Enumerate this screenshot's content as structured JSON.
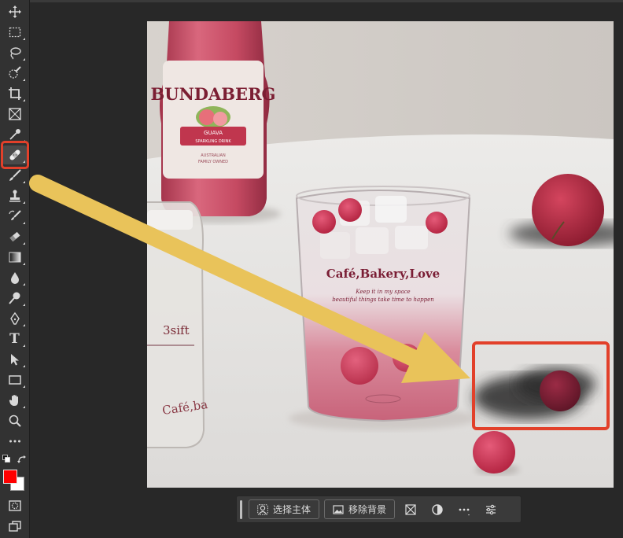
{
  "toolbar": {
    "tools": [
      {
        "name": "move-tool",
        "icon": "move-icon"
      },
      {
        "name": "marquee-tool",
        "icon": "marquee-icon"
      },
      {
        "name": "lasso-tool",
        "icon": "lasso-icon"
      },
      {
        "name": "quick-selection-tool",
        "icon": "quick-selection-icon"
      },
      {
        "name": "crop-tool",
        "icon": "crop-icon"
      },
      {
        "name": "frame-tool",
        "icon": "frame-icon"
      },
      {
        "name": "eyedropper-tool",
        "icon": "eyedropper-icon"
      },
      {
        "name": "spot-healing-brush-tool",
        "icon": "bandage-icon",
        "active": true
      },
      {
        "name": "brush-tool",
        "icon": "brush-icon"
      },
      {
        "name": "clone-stamp-tool",
        "icon": "stamp-icon"
      },
      {
        "name": "history-brush-tool",
        "icon": "history-brush-icon"
      },
      {
        "name": "eraser-tool",
        "icon": "eraser-icon"
      },
      {
        "name": "gradient-tool",
        "icon": "gradient-icon"
      },
      {
        "name": "blur-tool",
        "icon": "drop-icon"
      },
      {
        "name": "dodge-tool",
        "icon": "dodge-icon"
      },
      {
        "name": "pen-tool",
        "icon": "pen-icon"
      },
      {
        "name": "type-tool",
        "icon": "type-icon",
        "label": "T"
      },
      {
        "name": "path-selection-tool",
        "icon": "arrow-cursor-icon"
      },
      {
        "name": "rectangle-tool",
        "icon": "rectangle-icon"
      },
      {
        "name": "hand-tool",
        "icon": "hand-icon"
      },
      {
        "name": "zoom-tool",
        "icon": "zoom-icon"
      },
      {
        "name": "more-tools",
        "icon": "more-icon"
      }
    ],
    "foreground_color": "#ff0000",
    "background_color": "#ffffff"
  },
  "taskbar": {
    "select_subject_label": "选择主体",
    "remove_background_label": "移除背景"
  },
  "colors": {
    "annotation_red": "#e2402a",
    "arrow_yellow": "#e9c35a",
    "workspace": "#282828",
    "panel": "#323232"
  }
}
